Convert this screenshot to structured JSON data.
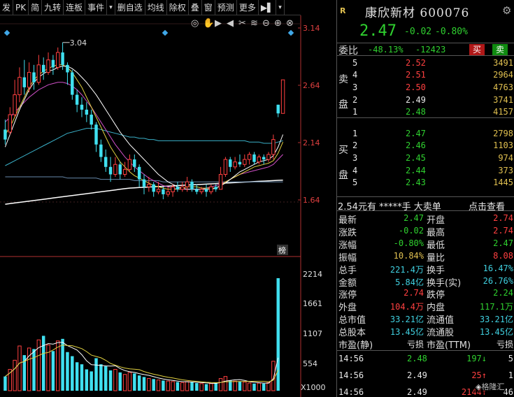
{
  "toolbar": {
    "items": [
      "发",
      "PK",
      "简",
      "九转",
      "连板",
      "事件",
      "▾",
      "删自选",
      "均线",
      "除权",
      "叠",
      "窗",
      "预测",
      "更多"
    ],
    "nav_arrow": "▶▌",
    "dropdown": "▾"
  },
  "chart": {
    "price_axis": [
      "3.14",
      "2.64",
      "2.14",
      "1.64"
    ],
    "high_label": "3.04",
    "volume_axis": [
      "2214",
      "1661",
      "1107",
      "554",
      "X1000"
    ],
    "badge": "榜",
    "candles": [
      [
        2.34,
        2.26,
        2.42,
        2.22
      ],
      [
        2.32,
        2.46,
        2.52,
        2.3
      ],
      [
        2.46,
        2.62,
        2.74,
        2.44
      ],
      [
        2.62,
        2.76,
        2.84,
        2.56
      ],
      [
        2.76,
        2.68,
        2.9,
        2.62
      ],
      [
        2.68,
        2.8,
        2.88,
        2.64
      ],
      [
        2.8,
        2.72,
        2.86,
        2.66
      ],
      [
        2.72,
        2.86,
        2.94,
        2.7
      ],
      [
        2.86,
        2.8,
        2.92,
        2.74
      ],
      [
        2.8,
        2.9,
        2.96,
        2.78
      ],
      [
        2.9,
        2.84,
        2.94,
        2.78
      ],
      [
        2.84,
        2.96,
        3.0,
        2.82
      ],
      [
        2.96,
        2.86,
        3.04,
        2.82
      ],
      [
        2.86,
        2.8,
        2.88,
        2.7
      ],
      [
        2.8,
        2.62,
        2.82,
        2.58
      ],
      [
        2.62,
        2.54,
        2.66,
        2.48
      ],
      [
        2.54,
        2.5,
        2.6,
        2.44
      ],
      [
        2.5,
        2.46,
        2.56,
        2.4
      ],
      [
        2.46,
        2.38,
        2.5,
        2.34
      ],
      [
        2.38,
        2.22,
        2.4,
        2.16
      ],
      [
        2.22,
        2.12,
        2.26,
        2.08
      ],
      [
        2.12,
        2.04,
        2.18,
        2.0
      ],
      [
        2.04,
        1.98,
        2.12,
        1.92
      ],
      [
        1.98,
        2.06,
        2.12,
        1.96
      ],
      [
        2.06,
        1.98,
        2.08,
        1.94
      ],
      [
        1.98,
        2.02,
        2.08,
        1.96
      ],
      [
        2.02,
        2.1,
        2.14,
        2.0
      ],
      [
        2.1,
        2.04,
        2.14,
        2.0
      ],
      [
        2.04,
        1.94,
        2.06,
        1.88
      ],
      [
        1.94,
        1.88,
        1.98,
        1.82
      ],
      [
        1.88,
        1.9,
        1.96,
        1.84
      ],
      [
        1.9,
        1.84,
        1.92,
        1.8
      ],
      [
        1.84,
        1.86,
        1.92,
        1.82
      ],
      [
        1.86,
        1.82,
        1.88,
        1.78
      ],
      [
        1.82,
        1.84,
        1.88,
        1.8
      ],
      [
        1.84,
        1.88,
        1.9,
        1.8
      ],
      [
        1.88,
        1.86,
        1.92,
        1.84
      ],
      [
        1.86,
        1.88,
        1.92,
        1.84
      ],
      [
        1.88,
        1.92,
        1.96,
        1.84
      ],
      [
        1.92,
        1.86,
        1.94,
        1.84
      ],
      [
        1.86,
        1.84,
        1.9,
        1.82
      ],
      [
        1.84,
        1.86,
        1.88,
        1.82
      ],
      [
        1.86,
        1.84,
        1.9,
        1.8
      ],
      [
        1.84,
        1.88,
        1.9,
        1.82
      ],
      [
        1.88,
        1.86,
        1.9,
        1.84
      ],
      [
        1.86,
        1.98,
        2.04,
        1.86
      ],
      [
        1.98,
        2.1,
        2.12,
        1.96
      ],
      [
        2.1,
        2.04,
        2.12,
        2.0
      ],
      [
        2.04,
        2.08,
        2.12,
        2.02
      ],
      [
        2.08,
        2.06,
        2.14,
        2.04
      ],
      [
        2.06,
        2.1,
        2.14,
        2.04
      ],
      [
        2.1,
        2.14,
        2.16,
        2.06
      ],
      [
        2.14,
        2.08,
        2.16,
        2.06
      ],
      [
        2.08,
        2.12,
        2.14,
        2.06
      ],
      [
        2.12,
        2.1,
        2.14,
        2.06
      ],
      [
        2.1,
        2.14,
        2.16,
        2.08
      ],
      [
        2.14,
        2.26,
        2.3,
        2.1
      ],
      [
        2.54,
        2.47,
        2.54,
        2.44
      ],
      [
        2.47,
        2.74,
        2.74,
        2.47
      ]
    ],
    "volumes": [
      280,
      420,
      600,
      880,
      700,
      840,
      820,
      1000,
      1080,
      900,
      780,
      980,
      1020,
      760,
      680,
      560,
      520,
      420,
      380,
      640,
      520,
      480,
      400,
      420,
      360,
      320,
      360,
      340,
      300,
      270,
      240,
      230,
      210,
      200,
      190,
      180,
      170,
      160,
      180,
      170,
      150,
      140,
      130,
      140,
      160,
      240,
      280,
      200,
      190,
      180,
      170,
      150,
      140,
      150,
      140,
      160,
      580,
      2214
    ],
    "ma_white": [
      2.2,
      2.3,
      2.4,
      2.5,
      2.58,
      2.66,
      2.72,
      2.76,
      2.79,
      2.81,
      2.82,
      2.84,
      2.85,
      2.85,
      2.83,
      2.8,
      2.76,
      2.72,
      2.67,
      2.62,
      2.56,
      2.5,
      2.44,
      2.38,
      2.32,
      2.27,
      2.22,
      2.18,
      2.14,
      2.1,
      2.06,
      2.02,
      1.98,
      1.95,
      1.92,
      1.9,
      1.88,
      1.87,
      1.86,
      1.86,
      1.86,
      1.86,
      1.86,
      1.86,
      1.87,
      1.89,
      1.91,
      1.94,
      1.97,
      2.0,
      2.02,
      2.04,
      2.06,
      2.08,
      2.09,
      2.1,
      2.13,
      2.2,
      2.3
    ],
    "ma_yellow": [
      2.3,
      2.36,
      2.44,
      2.52,
      2.6,
      2.68,
      2.74,
      2.78,
      2.81,
      2.83,
      2.85,
      2.86,
      2.86,
      2.84,
      2.8,
      2.74,
      2.68,
      2.6,
      2.52,
      2.44,
      2.36,
      2.28,
      2.2,
      2.14,
      2.08,
      2.04,
      2.0,
      1.97,
      1.95,
      1.93,
      1.91,
      1.89,
      1.88,
      1.87,
      1.86,
      1.86,
      1.86,
      1.87,
      1.88,
      1.88,
      1.88,
      1.87,
      1.87,
      1.87,
      1.87,
      1.89,
      1.92,
      1.94,
      1.96,
      1.98,
      2.0,
      2.02,
      2.04,
      2.05,
      2.06,
      2.07,
      2.09,
      2.15,
      2.24
    ],
    "ma_magenta": [
      2.4,
      2.44,
      2.48,
      2.52,
      2.56,
      2.6,
      2.63,
      2.66,
      2.68,
      2.7,
      2.71,
      2.72,
      2.72,
      2.71,
      2.69,
      2.66,
      2.62,
      2.57,
      2.52,
      2.46,
      2.4,
      2.34,
      2.28,
      2.22,
      2.17,
      2.12,
      2.08,
      2.04,
      2.01,
      1.98,
      1.95,
      1.93,
      1.91,
      1.89,
      1.88,
      1.87,
      1.86,
      1.86,
      1.86,
      1.86,
      1.86,
      1.86,
      1.87,
      1.88,
      1.89,
      1.9,
      1.92,
      1.94,
      1.96,
      1.98,
      1.99,
      2.0,
      2.01,
      2.02,
      2.03,
      2.04,
      2.06,
      2.1,
      2.14
    ],
    "ma_cyan": [
      2.05,
      2.07,
      2.09,
      2.11,
      2.13,
      2.15,
      2.17,
      2.19,
      2.21,
      2.23,
      2.25,
      2.27,
      2.29,
      2.31,
      2.32,
      2.33,
      2.34,
      2.35,
      2.35,
      2.35,
      2.34,
      2.33,
      2.32,
      2.31,
      2.3,
      2.29,
      2.28,
      2.28,
      2.27,
      2.27,
      2.26,
      2.26,
      2.25,
      2.25,
      2.25,
      2.25,
      2.25,
      2.25,
      2.25,
      2.25,
      2.25,
      2.25,
      2.25,
      2.25,
      2.25,
      2.25,
      2.25,
      2.25,
      2.25,
      2.25,
      2.25,
      2.24,
      2.24,
      2.24,
      2.23,
      2.23,
      2.23,
      2.24,
      2.25
    ],
    "ma_grey": [
      1.96,
      1.96,
      1.96,
      1.96,
      1.96,
      1.96,
      1.96,
      1.96,
      1.96,
      1.96,
      1.96,
      1.96,
      1.96,
      1.95,
      1.95,
      1.95,
      1.95,
      1.95,
      1.95,
      1.95,
      1.94,
      1.94,
      1.94,
      1.94,
      1.94,
      1.94,
      1.94,
      1.93,
      1.93,
      1.93,
      1.93,
      1.93,
      1.93,
      1.92,
      1.92,
      1.92,
      1.92,
      1.92,
      1.92,
      1.92,
      1.92,
      1.92,
      1.92,
      1.92,
      1.92,
      1.92,
      1.92,
      1.92,
      1.92,
      1.92,
      1.92,
      1.92,
      1.92,
      1.92,
      1.92,
      1.92,
      1.92,
      1.92,
      1.92
    ],
    "ma_base": [
      1.74,
      1.745,
      1.75,
      1.755,
      1.76,
      1.765,
      1.77,
      1.775,
      1.78,
      1.785,
      1.79,
      1.795,
      1.8,
      1.805,
      1.81,
      1.815,
      1.82,
      1.825,
      1.83,
      1.835,
      1.84,
      1.845,
      1.85,
      1.855,
      1.86,
      1.865,
      1.87,
      1.872,
      1.874,
      1.876,
      1.878,
      1.88,
      1.882,
      1.884,
      1.886,
      1.888,
      1.89,
      1.892,
      1.894,
      1.896,
      1.898,
      1.9,
      1.902,
      1.904,
      1.906,
      1.908,
      1.91,
      1.912,
      1.914,
      1.916,
      1.918,
      1.92,
      1.922,
      1.924,
      1.926,
      1.928,
      1.93,
      1.932,
      1.934
    ]
  },
  "quote": {
    "flag": "R",
    "name": "康欣新材",
    "code": "600076",
    "price": "2.47",
    "change": "-0.02",
    "pct": "-0.80%",
    "weibi_label": "委比",
    "weibi_pct": "-48.13%",
    "weibi_diff": "-12423",
    "buy_btn": "买",
    "sell_btn": "卖",
    "sell_label": [
      "卖",
      "盘"
    ],
    "buy_label": [
      "买",
      "盘"
    ],
    "asks": [
      {
        "lv": "5",
        "p": "2.52",
        "v": "3491",
        "c": "r"
      },
      {
        "lv": "4",
        "p": "2.51",
        "v": "2964",
        "c": "r"
      },
      {
        "lv": "3",
        "p": "2.50",
        "v": "4763",
        "c": "r"
      },
      {
        "lv": "2",
        "p": "2.49",
        "v": "3741",
        "c": "w"
      },
      {
        "lv": "1",
        "p": "2.48",
        "v": "4157",
        "c": "g"
      }
    ],
    "bids": [
      {
        "lv": "1",
        "p": "2.47",
        "v": "2798",
        "c": "g"
      },
      {
        "lv": "2",
        "p": "2.46",
        "v": "1103",
        "c": "g"
      },
      {
        "lv": "3",
        "p": "2.45",
        "v": "974",
        "c": "g"
      },
      {
        "lv": "4",
        "p": "2.44",
        "v": "373",
        "c": "g"
      },
      {
        "lv": "5",
        "p": "2.43",
        "v": "1445",
        "c": "g"
      }
    ],
    "bigorder": {
      "p": "2.54",
      "yuan": "元有",
      "stars": "*****",
      "shou": "手",
      "dmd": "大卖单",
      "link": "点击查看"
    },
    "stats": [
      [
        "最新",
        "2.47",
        "g",
        "开盘",
        "2.74",
        "r"
      ],
      [
        "涨跌",
        "-0.02",
        "g",
        "最高",
        "2.74",
        "r"
      ],
      [
        "涨幅",
        "-0.80%",
        "g",
        "最低",
        "2.47",
        "g"
      ],
      [
        "振幅",
        "10.84%",
        "y",
        "量比",
        "8.08",
        "r"
      ],
      [
        "总手",
        "221.4万",
        "c",
        "换手",
        "16.47%",
        "c"
      ],
      [
        "金额",
        "5.84亿",
        "c",
        "换手(实)",
        "26.76%",
        "c"
      ],
      [
        "涨停",
        "2.74",
        "r",
        "跌停",
        "2.24",
        "g"
      ],
      [
        "外盘",
        "104.4万",
        "r",
        "内盘",
        "117.1万",
        "g"
      ],
      [
        "总市值",
        "33.21亿",
        "c",
        "流通值",
        "33.21亿",
        "c"
      ],
      [
        "总股本",
        "13.45亿",
        "c",
        "流通股",
        "13.45亿",
        "c"
      ],
      [
        "市盈(静)",
        "亏损",
        "w",
        "市盈(TTM)",
        "亏损",
        "w"
      ]
    ],
    "ticks": [
      {
        "t": "14:56",
        "p": "2.48",
        "pc": "g",
        "v": "197",
        "vc": "g",
        "arr": "↓",
        "n": "5"
      },
      {
        "t": "14:56",
        "p": "2.49",
        "pc": "w",
        "v": "25",
        "vc": "r",
        "arr": "↑",
        "n": "1"
      },
      {
        "t": "14:56",
        "p": "2.49",
        "pc": "w",
        "v": "2144",
        "vc": "r",
        "arr": "↑",
        "n": "46"
      }
    ],
    "watermark": "格隆汇"
  }
}
